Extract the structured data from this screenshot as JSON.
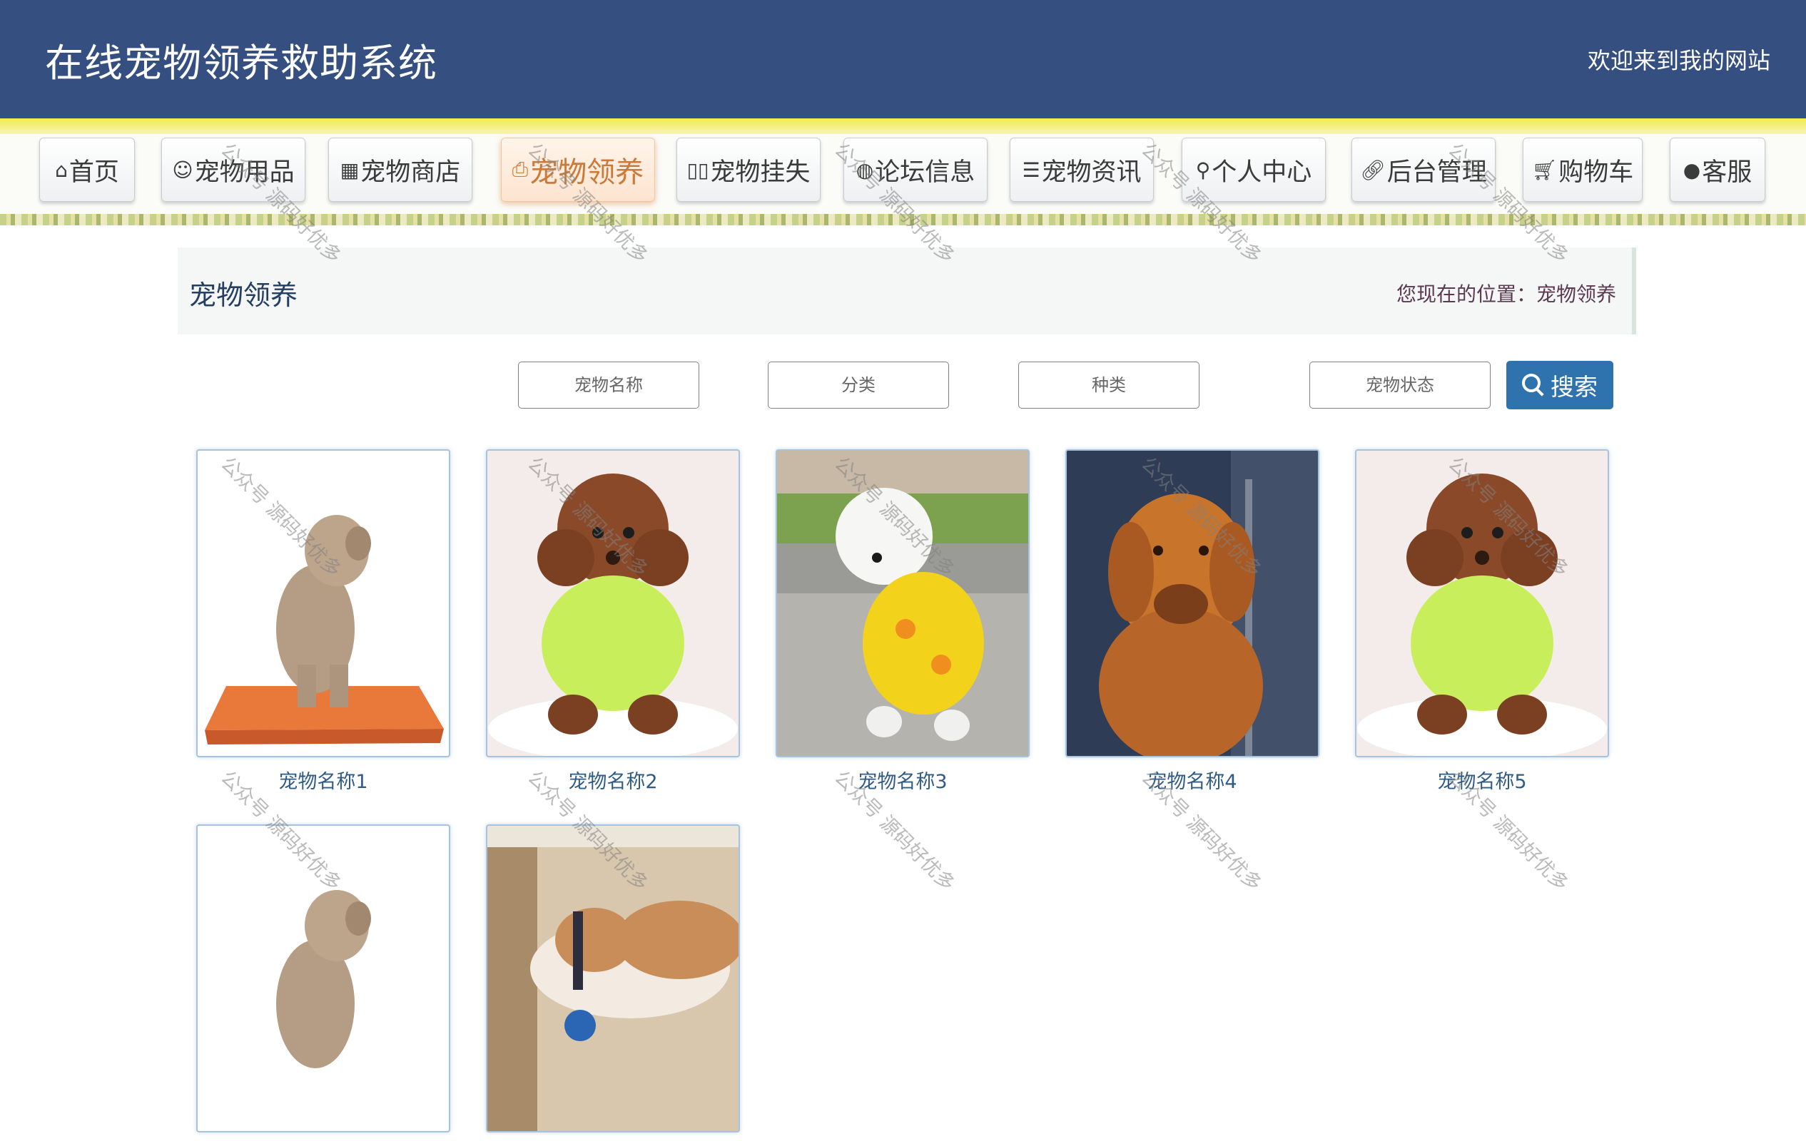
{
  "header": {
    "site_title": "在线宠物领养救助系统",
    "welcome": "欢迎来到我的网站"
  },
  "nav": {
    "items": [
      {
        "label": "首页",
        "icon": "home-icon"
      },
      {
        "label": "宠物用品",
        "icon": "smile-icon"
      },
      {
        "label": "宠物商店",
        "icon": "grid-icon"
      },
      {
        "label": "宠物领养",
        "icon": "printer-icon",
        "active": true
      },
      {
        "label": "宠物挂失",
        "icon": "columns-icon"
      },
      {
        "label": "论坛信息",
        "icon": "chat-icon"
      },
      {
        "label": "宠物资讯",
        "icon": "sliders-icon"
      },
      {
        "label": "个人中心",
        "icon": "user-icon"
      },
      {
        "label": "后台管理",
        "icon": "link-icon"
      },
      {
        "label": "购物车",
        "icon": "cart-icon"
      },
      {
        "label": "客服",
        "icon": "wechat-icon"
      }
    ],
    "active_color": "#cc7a3a"
  },
  "page": {
    "title": "宠物领养",
    "location": "您现在的位置：宠物领养"
  },
  "search": {
    "name_placeholder": "宠物名称",
    "category_placeholder": "分类",
    "breed_placeholder": "种类",
    "status_placeholder": "宠物状态",
    "button_label": "搜索",
    "button_color": "#2e72ae"
  },
  "pets": [
    {
      "name": "宠物名称1"
    },
    {
      "name": "宠物名称2"
    },
    {
      "name": "宠物名称3"
    },
    {
      "name": "宠物名称4"
    },
    {
      "name": "宠物名称5"
    },
    {
      "name": ""
    },
    {
      "name": ""
    }
  ],
  "watermark": "公众号 源码好优多",
  "colors": {
    "header_bg": "#344f80",
    "accent_strip": "#f3ec4c"
  }
}
